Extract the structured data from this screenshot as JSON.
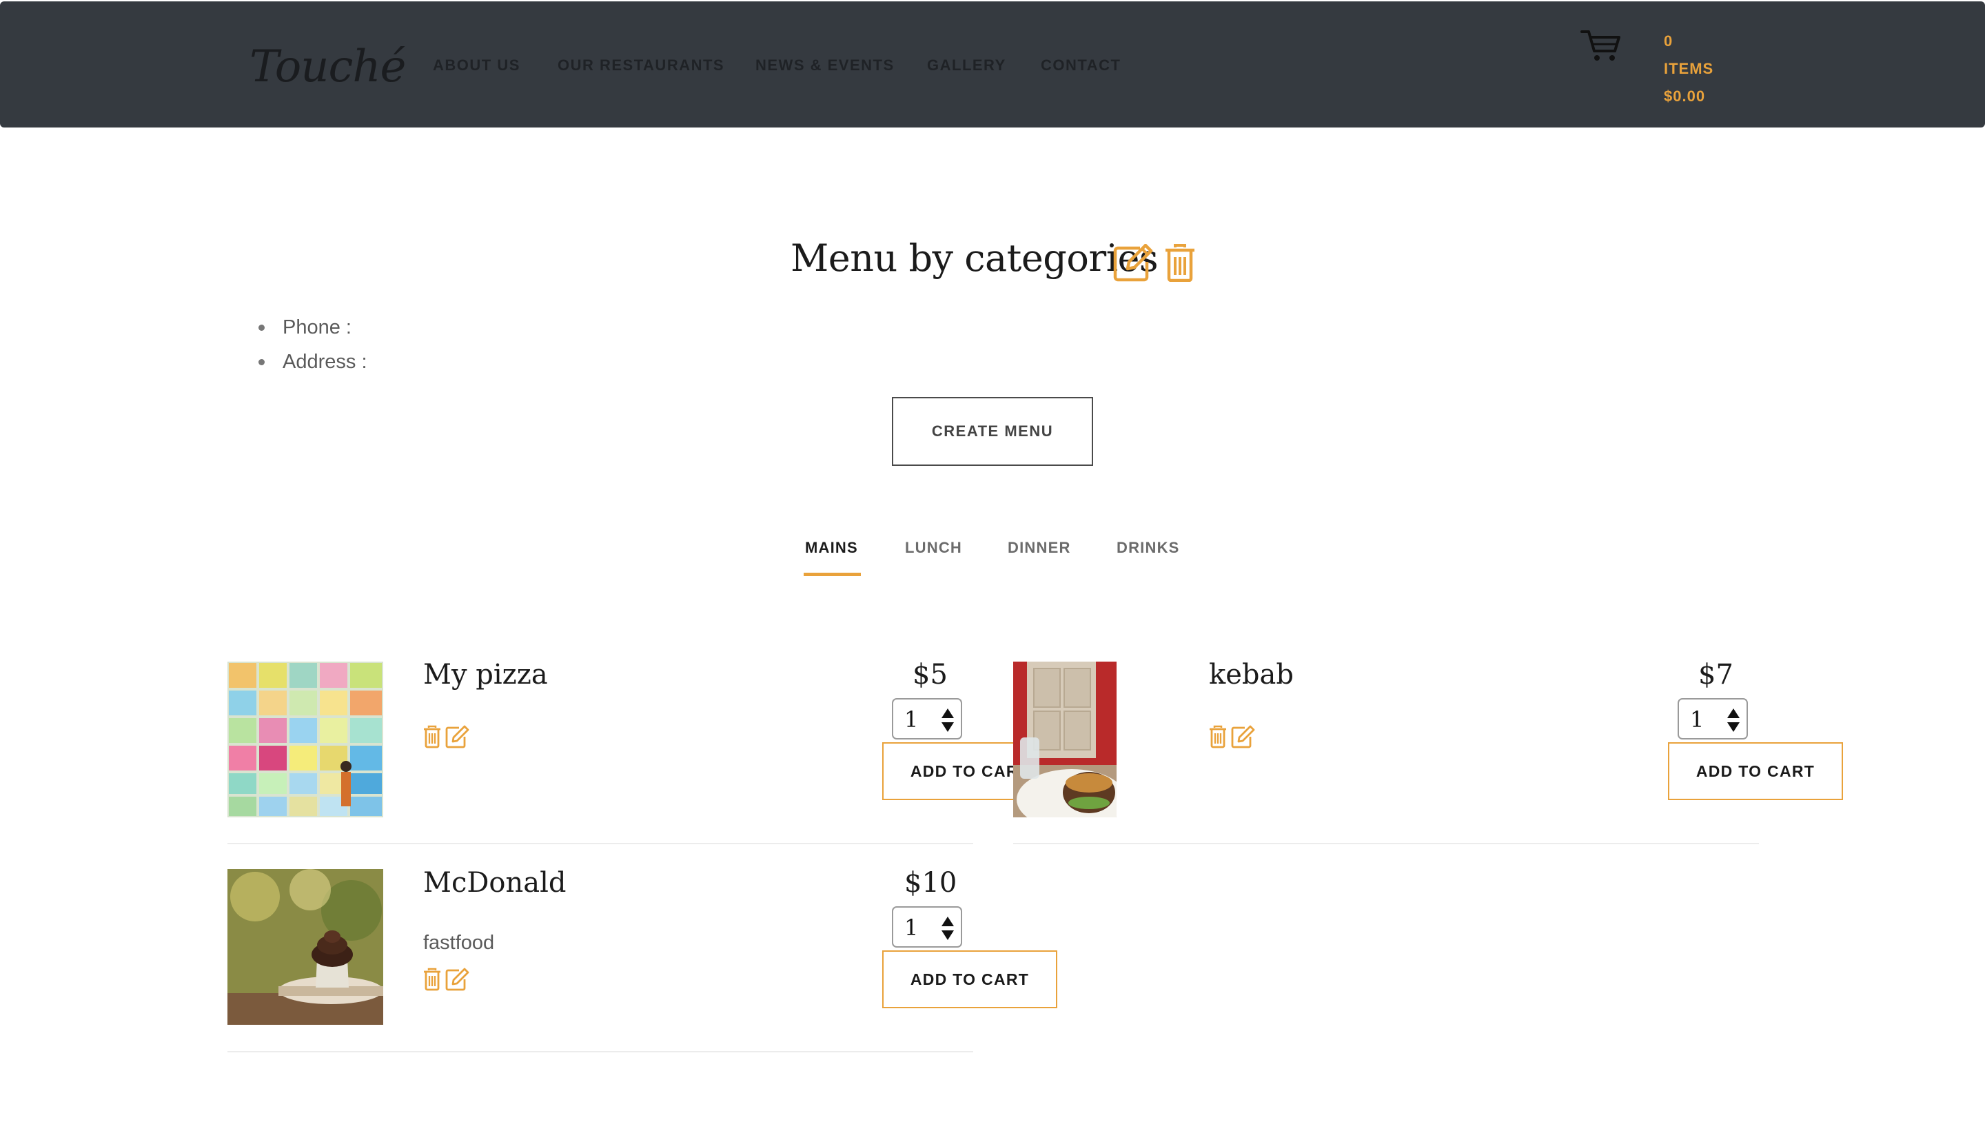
{
  "header": {
    "logo": "Touché",
    "nav": [
      "ABOUT US",
      "OUR RESTAURANTS",
      "NEWS & EVENTS",
      "GALLERY",
      "CONTACT"
    ],
    "cart": {
      "count": "0",
      "items_label": "ITEMS",
      "total": "$0.00"
    }
  },
  "page": {
    "title": "Menu by categories",
    "phone_label": "Phone :",
    "address_label": "Address :",
    "create_menu_label": "CREATE MENU"
  },
  "tabs": [
    "MAINS",
    "LUNCH",
    "DINNER",
    "DRINKS"
  ],
  "active_tab": "MAINS",
  "items": [
    {
      "name": "My pizza",
      "description": "",
      "price": "$5",
      "quantity": "1",
      "add_label": "ADD TO CART",
      "image": "colorful-ticket-wall-photo"
    },
    {
      "name": "kebab",
      "description": "",
      "price": "$7",
      "quantity": "1",
      "add_label": "ADD TO CART",
      "image": "burger-on-plate-photo"
    },
    {
      "name": "McDonald",
      "description": "fastfood",
      "price": "$10",
      "quantity": "1",
      "add_label": "ADD TO CART",
      "image": "chocolate-cupcake-photo"
    }
  ],
  "colors": {
    "accent": "#e9a23b",
    "header_bg": "#353a40"
  },
  "icons": [
    "cart-icon",
    "edit-icon",
    "trash-icon",
    "spinner-arrows-icon"
  ]
}
